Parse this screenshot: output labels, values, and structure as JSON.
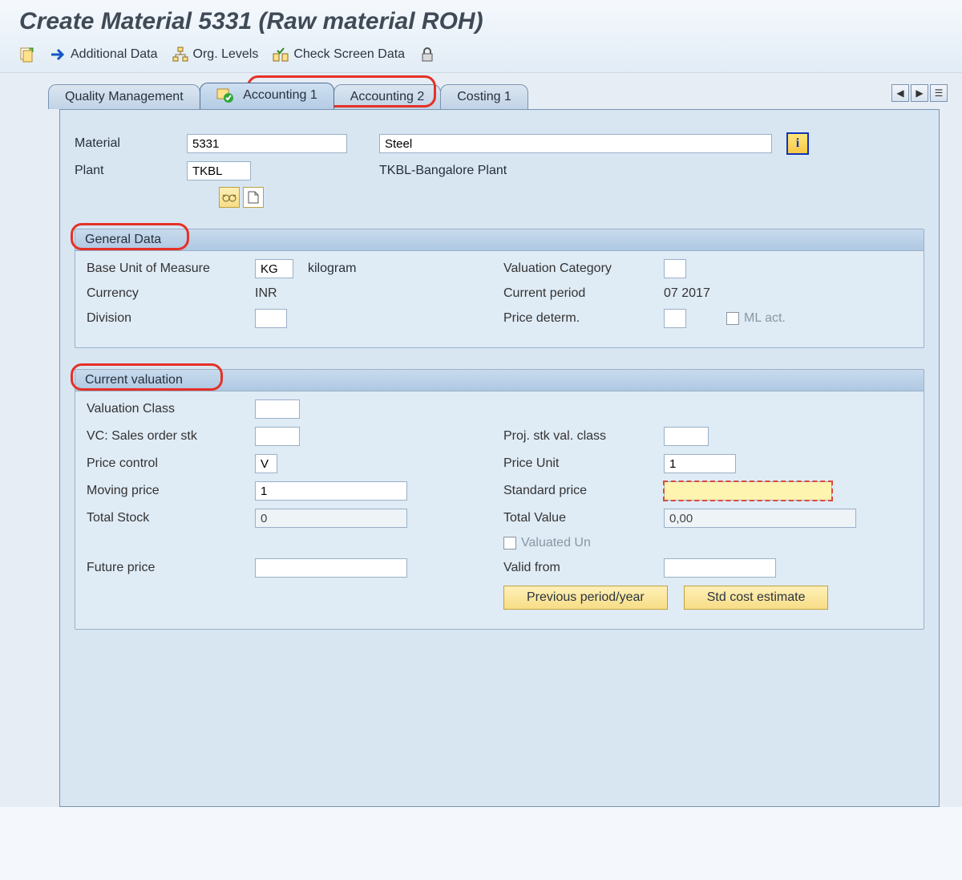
{
  "title": "Create Material 5331 (Raw material ROH)",
  "toolbar": {
    "additional_data": "Additional Data",
    "org_levels": "Org. Levels",
    "check_screen": "Check Screen Data"
  },
  "tabs": {
    "t0": "Quality Management",
    "t1": "Accounting 1",
    "t2": "Accounting 2",
    "t3": "Costing 1"
  },
  "header": {
    "material_label": "Material",
    "material_value": "5331",
    "material_desc": "Steel",
    "plant_label": "Plant",
    "plant_value": "TKBL",
    "plant_desc": "TKBL-Bangalore Plant"
  },
  "general": {
    "title": "General Data",
    "base_uom_label": "Base Unit of Measure",
    "base_uom": "KG",
    "base_uom_desc": "kilogram",
    "valuation_cat_label": "Valuation Category",
    "valuation_cat": "",
    "currency_label": "Currency",
    "currency": "INR",
    "current_period_label": "Current period",
    "current_period": "07 2017",
    "division_label": "Division",
    "division": "",
    "price_determ_label": "Price determ.",
    "price_determ": "",
    "ml_act_label": "ML act."
  },
  "valuation": {
    "title": "Current valuation",
    "valuation_class_label": "Valuation Class",
    "valuation_class": "",
    "vc_sales_label": "VC: Sales order stk",
    "vc_sales": "",
    "proj_stk_label": "Proj. stk val. class",
    "proj_stk": "",
    "price_control_label": "Price control",
    "price_control": "V",
    "price_unit_label": "Price Unit",
    "price_unit": "1",
    "moving_price_label": "Moving price",
    "moving_price": "1",
    "standard_price_label": "Standard price",
    "standard_price": "",
    "total_stock_label": "Total Stock",
    "total_stock": "0",
    "total_value_label": "Total Value",
    "total_value": "0,00",
    "valuated_un_label": "Valuated Un",
    "future_price_label": "Future price",
    "future_price": "",
    "valid_from_label": "Valid from",
    "valid_from": "",
    "prev_period_btn": "Previous period/year",
    "std_cost_btn": "Std cost estimate"
  }
}
